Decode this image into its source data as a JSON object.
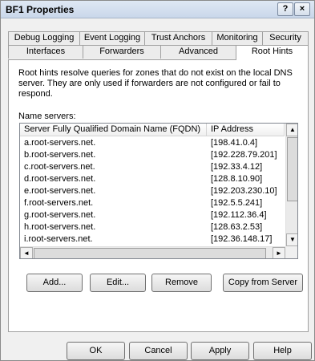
{
  "window": {
    "title": "BF1 Properties",
    "help_label": "?",
    "close_label": "×"
  },
  "tabs": {
    "row1": [
      "Debug Logging",
      "Event Logging",
      "Trust Anchors",
      "Monitoring",
      "Security"
    ],
    "row2": [
      "Interfaces",
      "Forwarders",
      "Advanced",
      "Root Hints"
    ],
    "selected": "Root Hints"
  },
  "root_hints": {
    "description": "Root hints resolve queries for zones that do not exist on the local DNS server.  They are only used if forwarders are not configured or fail to respond.",
    "name_servers_label": "Name servers:",
    "columns": [
      "Server Fully Qualified Domain Name (FQDN)",
      "IP Address"
    ],
    "rows": [
      {
        "fqdn": "a.root-servers.net.",
        "ip": "[198.41.0.4]"
      },
      {
        "fqdn": "b.root-servers.net.",
        "ip": "[192.228.79.201]"
      },
      {
        "fqdn": "c.root-servers.net.",
        "ip": "[192.33.4.12]"
      },
      {
        "fqdn": "d.root-servers.net.",
        "ip": "[128.8.10.90]"
      },
      {
        "fqdn": "e.root-servers.net.",
        "ip": "[192.203.230.10]"
      },
      {
        "fqdn": "f.root-servers.net.",
        "ip": "[192.5.5.241]"
      },
      {
        "fqdn": "g.root-servers.net.",
        "ip": "[192.112.36.4]"
      },
      {
        "fqdn": "h.root-servers.net.",
        "ip": "[128.63.2.53]"
      },
      {
        "fqdn": "i.root-servers.net.",
        "ip": "[192.36.148.17]"
      }
    ],
    "buttons": {
      "add": "Add...",
      "edit": "Edit...",
      "remove": "Remove",
      "copy": "Copy from Server"
    }
  },
  "scroll_glyphs": {
    "up": "▲",
    "down": "▼",
    "left": "◄",
    "right": "►"
  },
  "footer": {
    "ok": "OK",
    "cancel": "Cancel",
    "apply": "Apply",
    "help": "Help"
  }
}
